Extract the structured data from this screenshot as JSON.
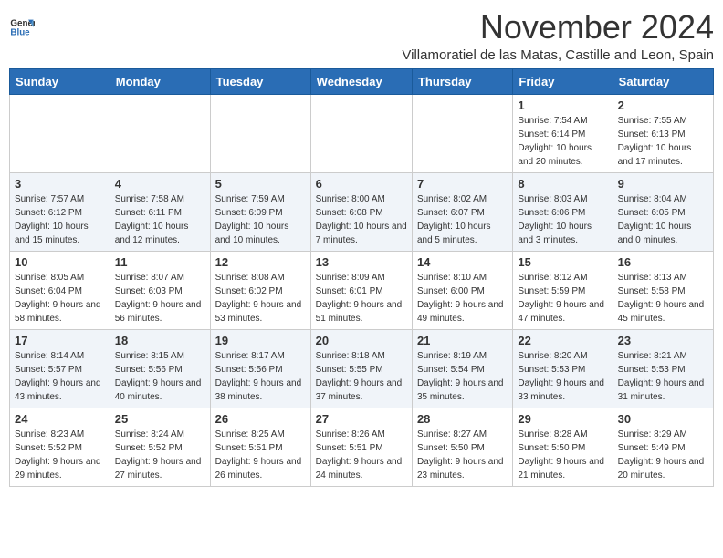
{
  "header": {
    "logo_general": "General",
    "logo_blue": "Blue",
    "month_title": "November 2024",
    "location": "Villamoratiel de las Matas, Castille and Leon, Spain"
  },
  "days_of_week": [
    "Sunday",
    "Monday",
    "Tuesday",
    "Wednesday",
    "Thursday",
    "Friday",
    "Saturday"
  ],
  "weeks": [
    [
      {
        "day": "",
        "info": ""
      },
      {
        "day": "",
        "info": ""
      },
      {
        "day": "",
        "info": ""
      },
      {
        "day": "",
        "info": ""
      },
      {
        "day": "",
        "info": ""
      },
      {
        "day": "1",
        "info": "Sunrise: 7:54 AM\nSunset: 6:14 PM\nDaylight: 10 hours and 20 minutes."
      },
      {
        "day": "2",
        "info": "Sunrise: 7:55 AM\nSunset: 6:13 PM\nDaylight: 10 hours and 17 minutes."
      }
    ],
    [
      {
        "day": "3",
        "info": "Sunrise: 7:57 AM\nSunset: 6:12 PM\nDaylight: 10 hours and 15 minutes."
      },
      {
        "day": "4",
        "info": "Sunrise: 7:58 AM\nSunset: 6:11 PM\nDaylight: 10 hours and 12 minutes."
      },
      {
        "day": "5",
        "info": "Sunrise: 7:59 AM\nSunset: 6:09 PM\nDaylight: 10 hours and 10 minutes."
      },
      {
        "day": "6",
        "info": "Sunrise: 8:00 AM\nSunset: 6:08 PM\nDaylight: 10 hours and 7 minutes."
      },
      {
        "day": "7",
        "info": "Sunrise: 8:02 AM\nSunset: 6:07 PM\nDaylight: 10 hours and 5 minutes."
      },
      {
        "day": "8",
        "info": "Sunrise: 8:03 AM\nSunset: 6:06 PM\nDaylight: 10 hours and 3 minutes."
      },
      {
        "day": "9",
        "info": "Sunrise: 8:04 AM\nSunset: 6:05 PM\nDaylight: 10 hours and 0 minutes."
      }
    ],
    [
      {
        "day": "10",
        "info": "Sunrise: 8:05 AM\nSunset: 6:04 PM\nDaylight: 9 hours and 58 minutes."
      },
      {
        "day": "11",
        "info": "Sunrise: 8:07 AM\nSunset: 6:03 PM\nDaylight: 9 hours and 56 minutes."
      },
      {
        "day": "12",
        "info": "Sunrise: 8:08 AM\nSunset: 6:02 PM\nDaylight: 9 hours and 53 minutes."
      },
      {
        "day": "13",
        "info": "Sunrise: 8:09 AM\nSunset: 6:01 PM\nDaylight: 9 hours and 51 minutes."
      },
      {
        "day": "14",
        "info": "Sunrise: 8:10 AM\nSunset: 6:00 PM\nDaylight: 9 hours and 49 minutes."
      },
      {
        "day": "15",
        "info": "Sunrise: 8:12 AM\nSunset: 5:59 PM\nDaylight: 9 hours and 47 minutes."
      },
      {
        "day": "16",
        "info": "Sunrise: 8:13 AM\nSunset: 5:58 PM\nDaylight: 9 hours and 45 minutes."
      }
    ],
    [
      {
        "day": "17",
        "info": "Sunrise: 8:14 AM\nSunset: 5:57 PM\nDaylight: 9 hours and 43 minutes."
      },
      {
        "day": "18",
        "info": "Sunrise: 8:15 AM\nSunset: 5:56 PM\nDaylight: 9 hours and 40 minutes."
      },
      {
        "day": "19",
        "info": "Sunrise: 8:17 AM\nSunset: 5:56 PM\nDaylight: 9 hours and 38 minutes."
      },
      {
        "day": "20",
        "info": "Sunrise: 8:18 AM\nSunset: 5:55 PM\nDaylight: 9 hours and 37 minutes."
      },
      {
        "day": "21",
        "info": "Sunrise: 8:19 AM\nSunset: 5:54 PM\nDaylight: 9 hours and 35 minutes."
      },
      {
        "day": "22",
        "info": "Sunrise: 8:20 AM\nSunset: 5:53 PM\nDaylight: 9 hours and 33 minutes."
      },
      {
        "day": "23",
        "info": "Sunrise: 8:21 AM\nSunset: 5:53 PM\nDaylight: 9 hours and 31 minutes."
      }
    ],
    [
      {
        "day": "24",
        "info": "Sunrise: 8:23 AM\nSunset: 5:52 PM\nDaylight: 9 hours and 29 minutes."
      },
      {
        "day": "25",
        "info": "Sunrise: 8:24 AM\nSunset: 5:52 PM\nDaylight: 9 hours and 27 minutes."
      },
      {
        "day": "26",
        "info": "Sunrise: 8:25 AM\nSunset: 5:51 PM\nDaylight: 9 hours and 26 minutes."
      },
      {
        "day": "27",
        "info": "Sunrise: 8:26 AM\nSunset: 5:51 PM\nDaylight: 9 hours and 24 minutes."
      },
      {
        "day": "28",
        "info": "Sunrise: 8:27 AM\nSunset: 5:50 PM\nDaylight: 9 hours and 23 minutes."
      },
      {
        "day": "29",
        "info": "Sunrise: 8:28 AM\nSunset: 5:50 PM\nDaylight: 9 hours and 21 minutes."
      },
      {
        "day": "30",
        "info": "Sunrise: 8:29 AM\nSunset: 5:49 PM\nDaylight: 9 hours and 20 minutes."
      }
    ]
  ]
}
